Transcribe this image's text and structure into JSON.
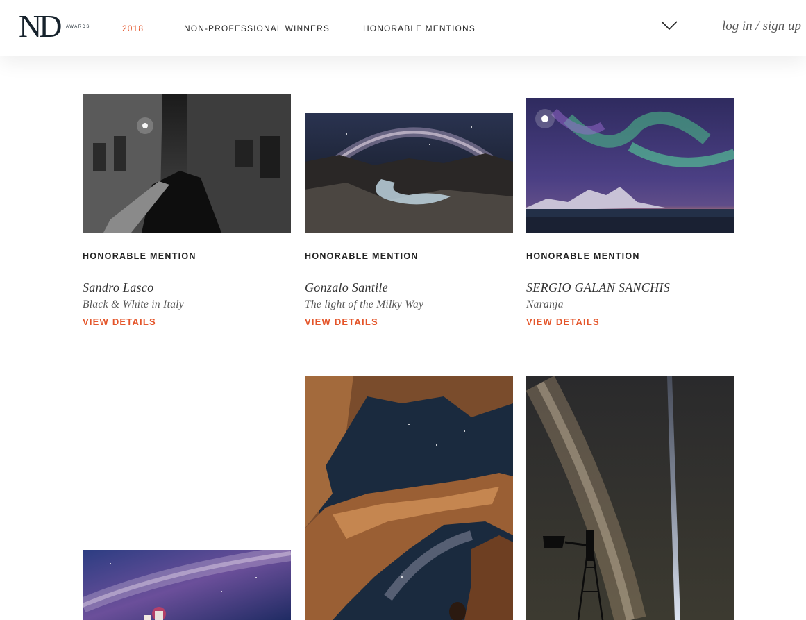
{
  "header": {
    "logo_text": "ND",
    "logo_sub": "AWARDS",
    "nav": [
      {
        "label": "2018"
      },
      {
        "label": "NON-PROFESSIONAL WINNERS"
      },
      {
        "label": "HONORABLE MENTIONS"
      }
    ],
    "menu_icon": "chevron-down-icon",
    "login": "log in / sign up"
  },
  "colors": {
    "accent": "#e4552a",
    "text_dark": "#16222c"
  },
  "cards": [
    {
      "badge": "HONORABLE MENTION",
      "author": "Sandro Lasco",
      "title": "Black & White in Italy",
      "link": "VIEW DETAILS"
    },
    {
      "badge": "HONORABLE MENTION",
      "author": "Gonzalo Santile",
      "title": "The light of the Milky Way",
      "link": "VIEW DETAILS"
    },
    {
      "badge": "HONORABLE MENTION",
      "author": "SERGIO GALAN SANCHIS",
      "title": "Naranja",
      "link": "VIEW DETAILS"
    }
  ]
}
